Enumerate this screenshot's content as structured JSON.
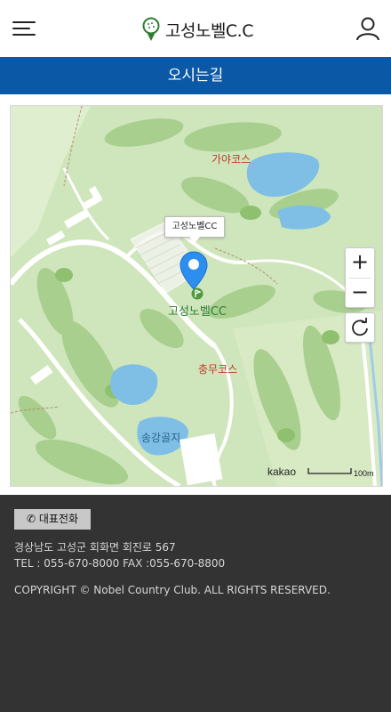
{
  "header": {
    "logo_text": "고성노벨C.C"
  },
  "title_bar": {
    "title": "오시는길"
  },
  "map": {
    "tooltip": "고성노벨CC",
    "marker_label": "고성노벨CC",
    "labels": {
      "gaya": "가야코스",
      "chungmu": "충무코스",
      "songgang": "송강골지"
    },
    "zoom_in": "+",
    "zoom_out": "−",
    "attribution": "kakao",
    "scale_label": "100m"
  },
  "footer": {
    "call_button": "대표전화",
    "address": "경상남도 고성군 회화면 회진로 567",
    "contact": "TEL : 055-670-8000   FAX :055-670-8800",
    "copyright": "COPYRIGHT © Nobel Country Club. ALL RIGHTS RESERVED."
  }
}
